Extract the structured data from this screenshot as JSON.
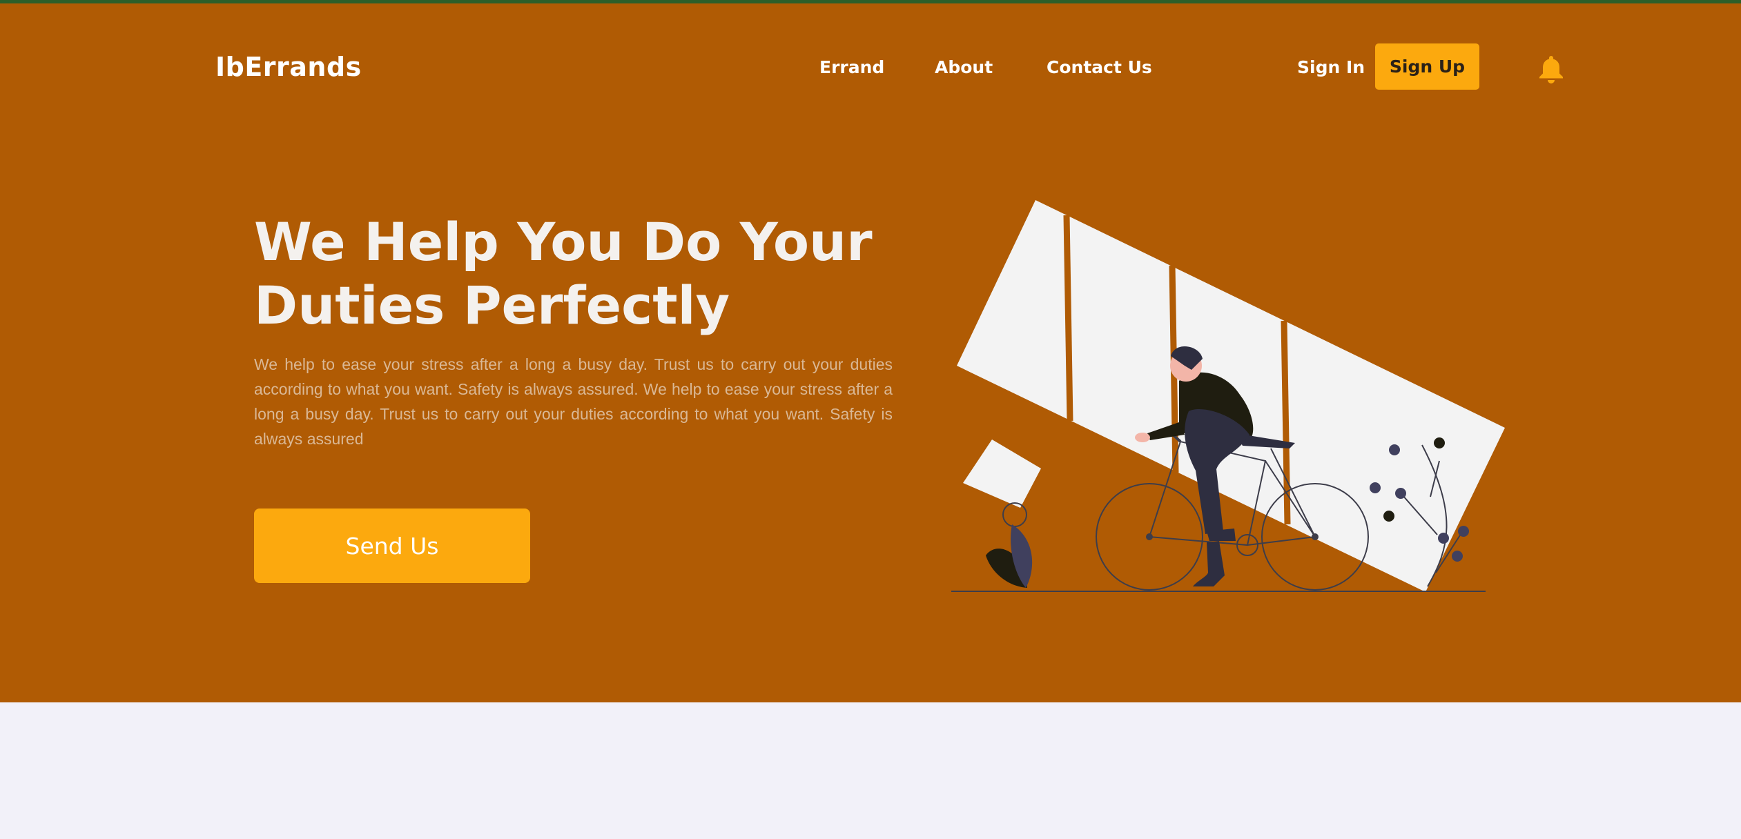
{
  "brand": {
    "name": "IbErrands"
  },
  "nav": {
    "items": [
      "Errand",
      "About",
      "Contact Us"
    ],
    "sign_in": "Sign In",
    "sign_up": "Sign Up"
  },
  "hero": {
    "headline": "We Help You Do Your Duties Perfectly",
    "description": "We help to ease your stress after a long a busy day. Trust us to carry out your duties according to what you want. Safety is always assured. We help to ease your stress after a long a busy day. Trust us to carry out your duties according to what you want. Safety is always assured",
    "cta_label": "Send Us"
  },
  "colors": {
    "top_border": "#2d5f2a",
    "hero_background": "#b05b04",
    "accent": "#fca90e",
    "page_background": "#f2f1f9"
  },
  "icons": {
    "notifications": "bell-icon"
  }
}
